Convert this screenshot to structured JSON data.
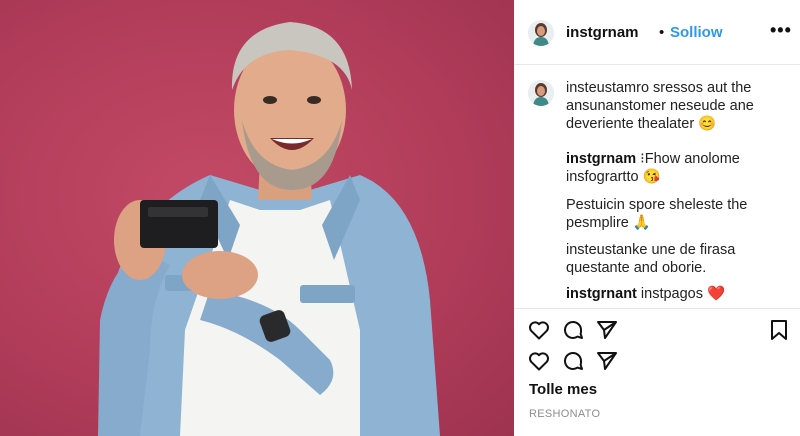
{
  "post": {
    "account": {
      "username": "instgrnam",
      "separator": "•",
      "follow_label": "Solliow",
      "more_label": "•••"
    },
    "caption": {
      "line1": "insteustamro sressos aut the",
      "line2": "ansunanstomer neseude ane",
      "line3": "deveriente thealater 😊"
    },
    "comments": [
      {
        "user": "instgrnam",
        "text_inline": "⁝Fhow anolome",
        "line2": "insfogrartto 😘"
      },
      {
        "line1": "Pestuicin spore sheleste the",
        "line2": "pesmplire 🙏"
      },
      {
        "line1": "insteustanke une de firasa",
        "line2": "questante and oborie."
      },
      {
        "user": "instgrnant",
        "text_inline": "instpagos ❤️"
      }
    ],
    "likes_label": "Tolle mes",
    "timestamp": "RESHONATO",
    "icons": {
      "like": "heart-outline-icon",
      "comment": "comment-bubble-icon",
      "share": "paper-plane-icon",
      "save": "bookmark-icon",
      "more": "more-dots-icon"
    },
    "colors": {
      "background": "#b23d5a",
      "follow": "#2b9be6",
      "divider": "#e6e6e6"
    }
  }
}
